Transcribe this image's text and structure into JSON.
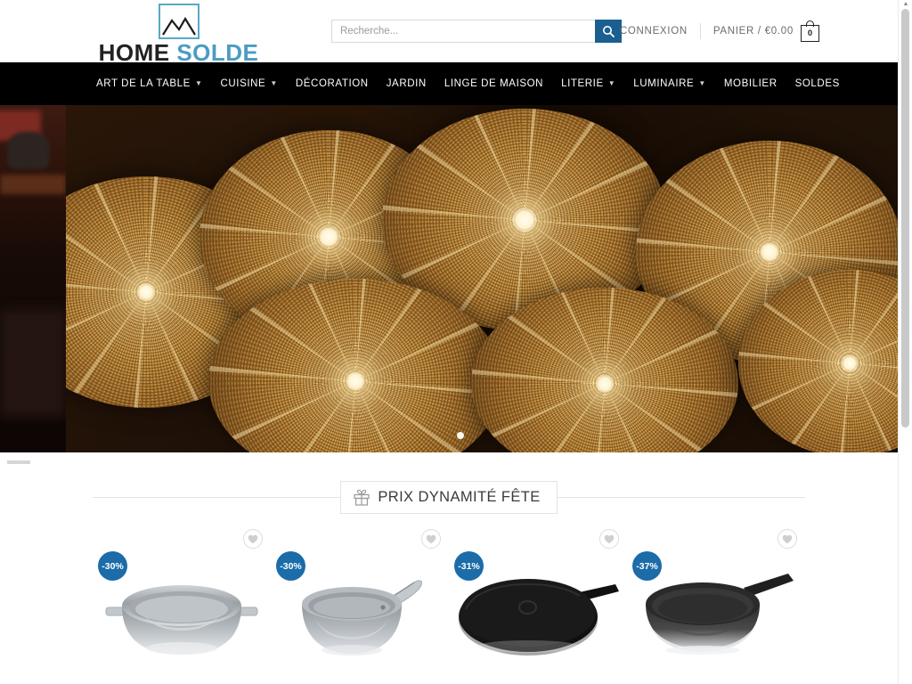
{
  "site": {
    "logo_text_dark": "HOME",
    "logo_text_blue": "SOLDE",
    "logo_icon": "mountain-frame-icon"
  },
  "search": {
    "placeholder": "Recherche...",
    "value": "",
    "button_icon": "search-icon"
  },
  "account": {
    "login_label": "CONNEXION",
    "cart_label": "PANIER / €0.00",
    "cart_count": "0",
    "cart_icon": "shopping-bag-icon"
  },
  "nav": {
    "items": [
      {
        "label": "ART DE LA TABLE",
        "has_dropdown": true
      },
      {
        "label": "CUISINE",
        "has_dropdown": true
      },
      {
        "label": "DÉCORATION",
        "has_dropdown": false
      },
      {
        "label": "JARDIN",
        "has_dropdown": false
      },
      {
        "label": "LINGE DE MAISON",
        "has_dropdown": false
      },
      {
        "label": "LITERIE",
        "has_dropdown": true
      },
      {
        "label": "LUMINAIRE",
        "has_dropdown": true
      },
      {
        "label": "MOBILIER",
        "has_dropdown": false
      },
      {
        "label": "SOLDES",
        "has_dropdown": false
      }
    ]
  },
  "hero": {
    "description": "Dark interior with illuminated woven rattan pendant lamp shades",
    "slide_count": 1,
    "active_slide": 1
  },
  "section": {
    "title": "PRIX DYNAMITÉ FÊTE",
    "icon": "gift-icon"
  },
  "products": [
    {
      "discount": "-30%",
      "image": "stainless-steel-pan",
      "wishlist_icon": "heart-icon"
    },
    {
      "discount": "-30%",
      "image": "steel-saute-pan",
      "wishlist_icon": "heart-icon"
    },
    {
      "discount": "-31%",
      "image": "black-crepe-pan",
      "wishlist_icon": "heart-icon"
    },
    {
      "discount": "-37%",
      "image": "black-frying-pan",
      "wishlist_icon": "heart-icon"
    }
  ],
  "colors": {
    "accent_blue": "#1b6ca8",
    "search_button_blue": "#1b5f91",
    "logo_blue": "#4a9cc4",
    "nav_background": "#000000"
  },
  "scrollbar": {
    "arrow": "▲"
  }
}
